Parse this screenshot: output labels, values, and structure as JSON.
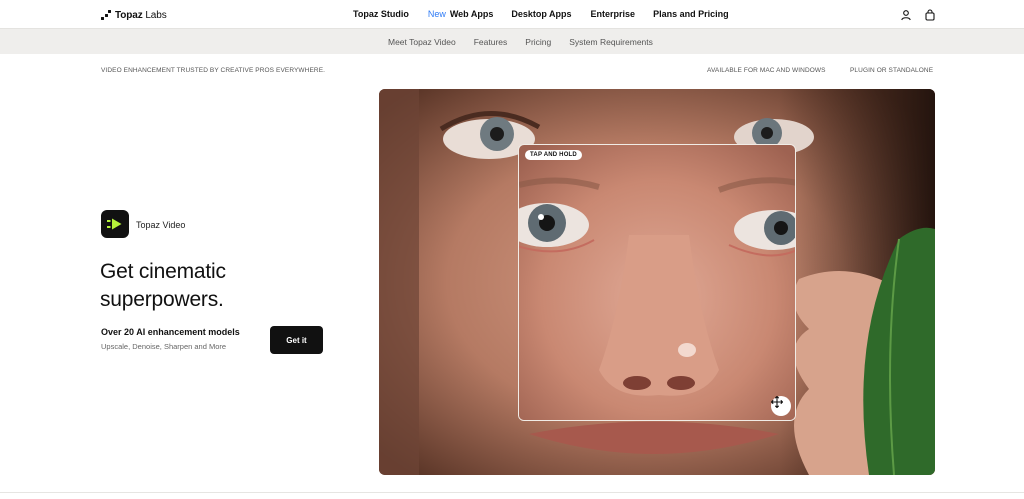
{
  "brand": {
    "name": "Topaz",
    "suffix": " Labs"
  },
  "nav": {
    "items": [
      {
        "label": "Topaz Studio"
      },
      {
        "badge": "New",
        "label": "Web Apps"
      },
      {
        "label": "Desktop Apps"
      },
      {
        "label": "Enterprise"
      },
      {
        "label": "Plans and Pricing"
      }
    ],
    "icons": [
      "user-icon",
      "bag-icon"
    ]
  },
  "subnav": {
    "items": [
      {
        "label": "Meet Topaz Video"
      },
      {
        "label": "Features"
      },
      {
        "label": "Pricing"
      },
      {
        "label": "System Requirements"
      }
    ]
  },
  "strip": {
    "left": "VIDEO ENHANCEMENT TRUSTED BY CREATIVE PROS EVERYWHERE.",
    "right1": "AVAILABLE FOR MAC AND WINDOWS",
    "right2": "PLUGIN OR STANDALONE"
  },
  "product": {
    "name": "Topaz Video",
    "headline": "Get cinematic superpowers.",
    "feature_title": "Over 20 AI enhancement models",
    "feature_sub": "Upscale, Denoise, Sharpen and More",
    "cta": "Get it",
    "icon": "play-icon",
    "icon_color": "#b6f23a"
  },
  "hero": {
    "badge": "TAP AND HOLD",
    "move_icon": "move-icon"
  }
}
